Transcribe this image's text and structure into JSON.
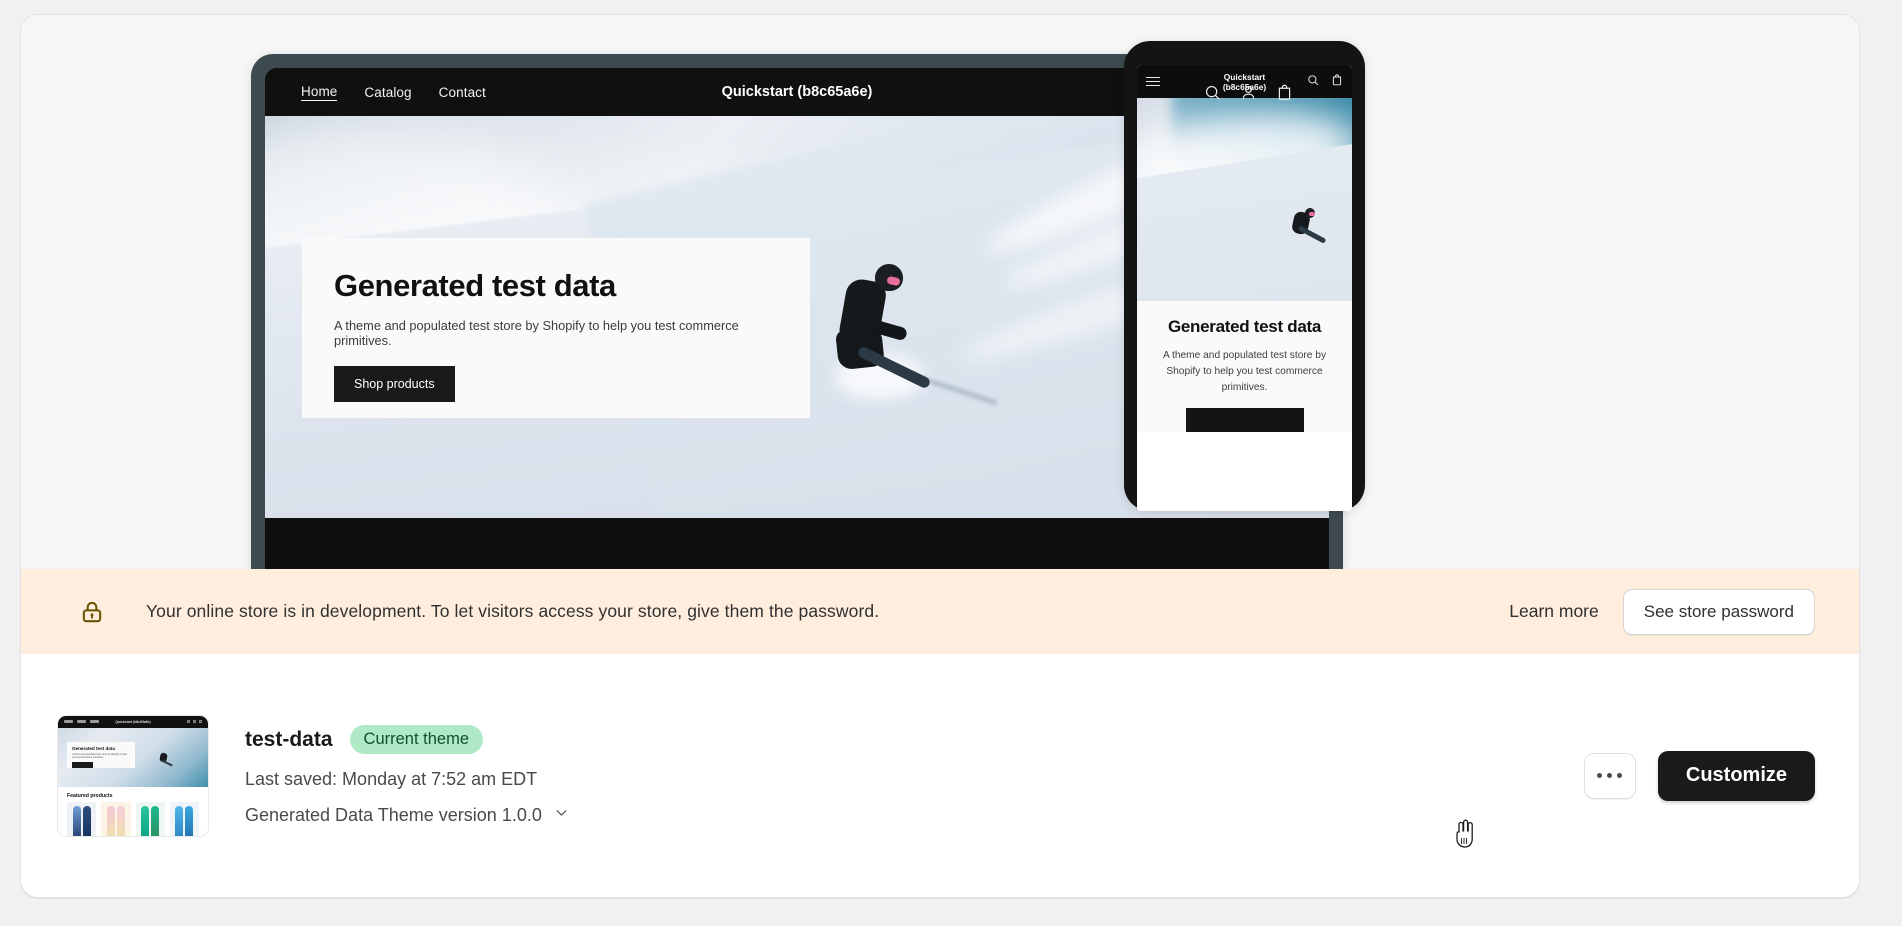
{
  "preview": {
    "desktop": {
      "nav_links": [
        {
          "label": "Home",
          "active": true
        },
        {
          "label": "Catalog",
          "active": false
        },
        {
          "label": "Contact",
          "active": false
        }
      ],
      "store_title": "Quickstart (b8c65a6e)",
      "icons": [
        "search-icon",
        "account-icon",
        "cart-icon"
      ],
      "hero": {
        "title": "Generated test data",
        "subtitle": "A theme and populated test store by Shopify to help you test commerce primitives.",
        "button_label": "Shop products"
      }
    },
    "mobile": {
      "menu_icon": "hamburger-icon",
      "store_title_line1": "Quickstart",
      "store_title_line2": "(b8c65a6e)",
      "icons": [
        "search-icon",
        "cart-icon"
      ],
      "hero": {
        "title": "Generated test data",
        "subtitle": "A theme and populated test store by Shopify to help you test commerce primitives."
      }
    }
  },
  "dev_banner": {
    "icon": "lock-icon",
    "message": "Your online store is in development. To let visitors access your store, give them the password.",
    "learn_more_label": "Learn more",
    "password_button_label": "See store password",
    "background_color": "#ffeede",
    "icon_color": "#6b5100"
  },
  "theme_row": {
    "thumbnail": {
      "store_title": "Quickstart (b8c65a6e)",
      "hero_title": "Generated test data",
      "hero_subtitle": "A theme and populated test store by Shopify to help you test commerce primitives.",
      "hero_button": "Shop products",
      "section_title": "Featured products",
      "product_colors": [
        "#2f4f7f",
        "#e9b9c9",
        "#27c6a0",
        "#3aa8e0"
      ]
    },
    "theme_name": "test-data",
    "badge_label": "Current theme",
    "badge_bg": "#afe9c6",
    "badge_fg": "#0c5132",
    "last_saved": "Last saved: Monday at 7:52 am EDT",
    "version_label": "Generated Data Theme version 1.0.0",
    "version_chevron": "chevron-down-icon",
    "more_actions_label": "more-actions",
    "customize_label": "Customize",
    "customize_bg": "#1a1a1a"
  }
}
